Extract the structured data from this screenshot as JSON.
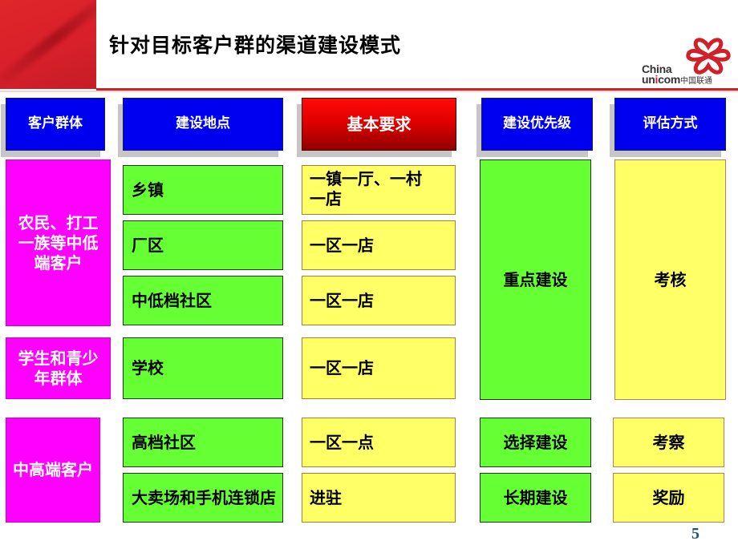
{
  "slide": {
    "title": "针对目标客户群的渠道建设模式",
    "page_number": "5"
  },
  "logo": {
    "brand_en_line1": "China",
    "brand_en_line2_a": "un",
    "brand_en_line2_i": "i",
    "brand_en_line2_b": "com",
    "brand_cn": "中国联通",
    "icon": "china-unicom-knot-icon"
  },
  "colors": {
    "header_blue": "#0000f0",
    "header_red": "#e00000",
    "group_magenta": "#ff00ff",
    "location_green": "#66ff33",
    "requirement_yellow": "#ffff66",
    "brand_red": "#d0202a"
  },
  "headers": {
    "customer_group": "客户群体",
    "location": "建设地点",
    "requirement": "基本要求",
    "priority": "建设优先级",
    "evaluation": "评估方式"
  },
  "groups": [
    {
      "name": "农民、打工一族等中低端客户",
      "rows": [
        {
          "location": "乡镇",
          "requirement": "一镇一厅、一村一店"
        },
        {
          "location": "厂区",
          "requirement": "一区一店"
        },
        {
          "location": "中低档社区",
          "requirement": "一区一店"
        }
      ]
    },
    {
      "name": "学生和青少年群体",
      "rows": [
        {
          "location": "学校",
          "requirement": "一区一店"
        }
      ]
    },
    {
      "name": "中高端客户",
      "rows": [
        {
          "location": "高档社区",
          "requirement": "一区一点",
          "priority": "选择建设",
          "evaluation": "考察"
        },
        {
          "location": "大卖场和手机连锁店",
          "requirement": "进驻",
          "priority": "长期建设",
          "evaluation": "奖励"
        }
      ]
    }
  ],
  "merged": {
    "priority_low_mid": "重点建设",
    "evaluation_low_mid": "考核"
  }
}
